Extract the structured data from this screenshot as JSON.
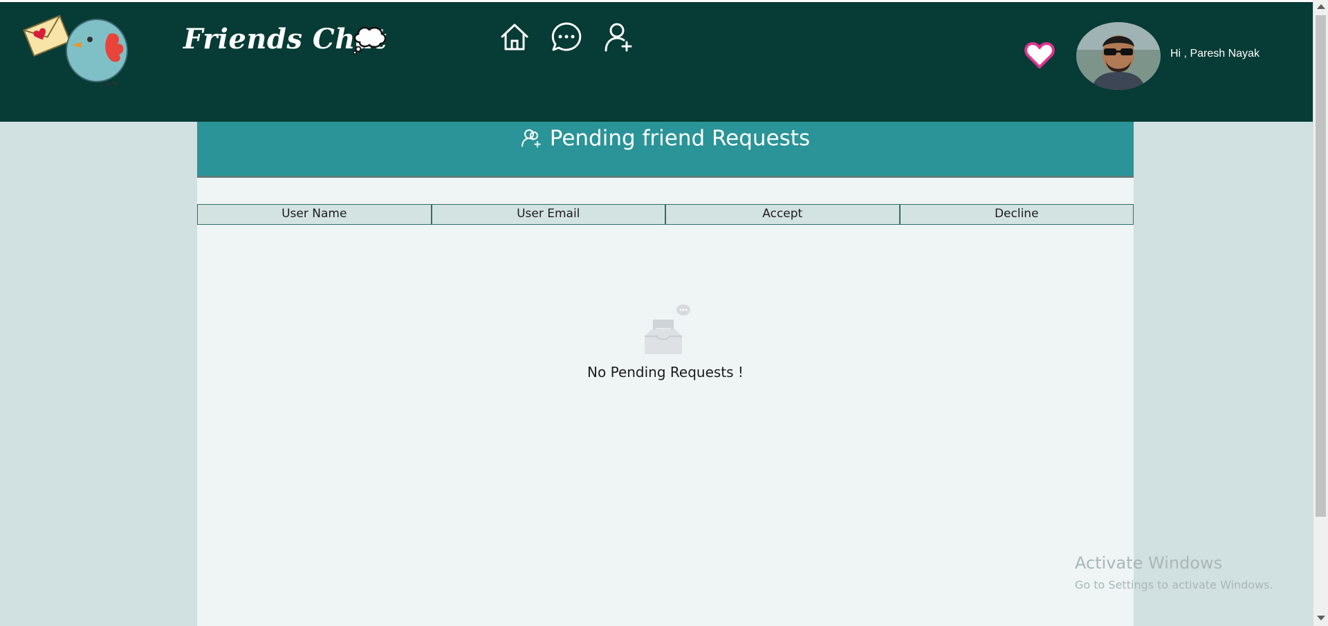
{
  "header": {
    "app_title": "Friends Chat",
    "logo_icon": "bird-with-love-letter-icon",
    "nav": [
      {
        "name": "home-icon"
      },
      {
        "name": "chat-bubble-icon"
      },
      {
        "name": "add-friend-icon"
      }
    ],
    "favorites_icon": "heart-icon",
    "greeting": "Hi , Paresh Nayak"
  },
  "page": {
    "heading": "Pending friend Requests",
    "heading_icon": "add-user-icon"
  },
  "table": {
    "columns": [
      "User Name",
      "User Email",
      "Accept",
      "Decline"
    ]
  },
  "empty_state": {
    "icon": "empty-inbox-icon",
    "text": "No Pending Requests !"
  },
  "watermark": {
    "title": "Activate Windows",
    "subtitle": "Go to Settings to activate Windows."
  },
  "colors": {
    "header_bg": "#073b35",
    "banner_bg": "#2a9498",
    "page_bg": "#d1e1e1",
    "content_bg": "#eef5f4",
    "heart": "#e0338f"
  }
}
